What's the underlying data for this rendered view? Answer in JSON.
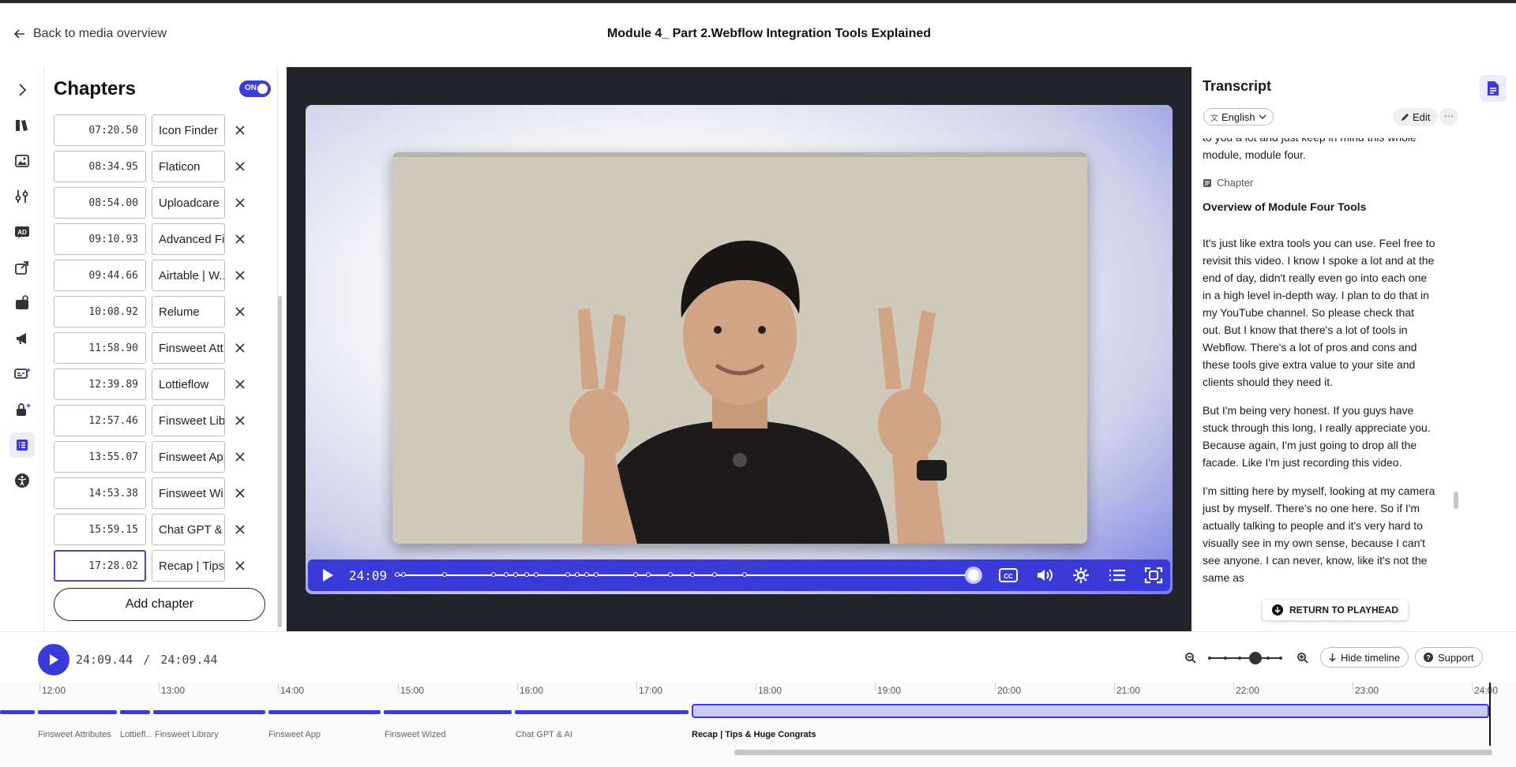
{
  "header": {
    "back_label": "Back to media overview",
    "title": "Module 4_ Part 2.Webflow Integration Tools Explained"
  },
  "chapters": {
    "title": "Chapters",
    "toggle_label": "ON",
    "add_label": "Add chapter",
    "items": [
      {
        "time": "07:20.50",
        "name": "Icon Finder"
      },
      {
        "time": "08:34.95",
        "name": "Flaticon"
      },
      {
        "time": "08:54.00",
        "name": "Uploadcare"
      },
      {
        "time": "09:10.93",
        "name": "Advanced Fi..."
      },
      {
        "time": "09:44.66",
        "name": "Airtable | W..."
      },
      {
        "time": "10:08.92",
        "name": "Relume"
      },
      {
        "time": "11:58.90",
        "name": "Finsweet Att..."
      },
      {
        "time": "12:39.89",
        "name": "Lottieflow"
      },
      {
        "time": "12:57.46",
        "name": "Finsweet Lib..."
      },
      {
        "time": "13:55.07",
        "name": "Finsweet App"
      },
      {
        "time": "14:53.38",
        "name": "Finsweet Wi..."
      },
      {
        "time": "15:59.15",
        "name": "Chat GPT & AI"
      },
      {
        "time": "17:28.02",
        "name": "Recap | Tips..."
      }
    ]
  },
  "player": {
    "current_time": "24:09"
  },
  "transcript": {
    "title": "Transcript",
    "language": "English",
    "edit_label": "Edit",
    "more_label": "···",
    "chapter_tag": "Chapter",
    "chapter_name": "Overview of Module Four Tools",
    "return_label": "RETURN TO PLAYHEAD",
    "paragraphs": [
      "to you a lot and just keep in mind this whole module, module four.",
      "It's just like extra tools you can use. Feel free to revisit this video. I know I spoke a lot and at the end of day, didn't really even go into each one in a high level in-depth way. I plan to do that in my YouTube channel. So please check that out. But I know that there's a lot of tools in Webflow. There's a lot of pros and cons and these tools give extra value to your site and clients should they need it.",
      "But I'm being very honest. If you guys have stuck through this long, I really appreciate you. Because again, I'm just going to drop all the facade. Like I'm just recording this video.",
      "I'm sitting here by myself, looking at my camera just by myself. There's no one here. So if I'm actually talking to people and it's very hard to visually see in my own sense, because I can't see anyone. I can never, know, like it's not the same as"
    ]
  },
  "bottom": {
    "time_current": "24:09.44",
    "time_sep": "/",
    "time_total": "24:09.44",
    "hide_timeline": "Hide timeline",
    "support": "Support"
  },
  "timeline": {
    "ticks": [
      "12:00",
      "13:00",
      "14:00",
      "15:00",
      "16:00",
      "17:00",
      "18:00",
      "19:00",
      "20:00",
      "21:00",
      "22:00",
      "23:00",
      "24:00"
    ],
    "segments": [
      {
        "label": "Finsweet Attributes"
      },
      {
        "label": "Lottiefl..."
      },
      {
        "label": "Finsweet Library"
      },
      {
        "label": "Finsweet App"
      },
      {
        "label": "Finsweet Wized"
      },
      {
        "label": "Chat GPT & AI"
      },
      {
        "label": "Recap | Tips & Huge Congrats"
      }
    ]
  },
  "colors": {
    "accent": "#3a3ad8",
    "accent_light": "#c9cbf7",
    "video_bg": "#23232a"
  }
}
